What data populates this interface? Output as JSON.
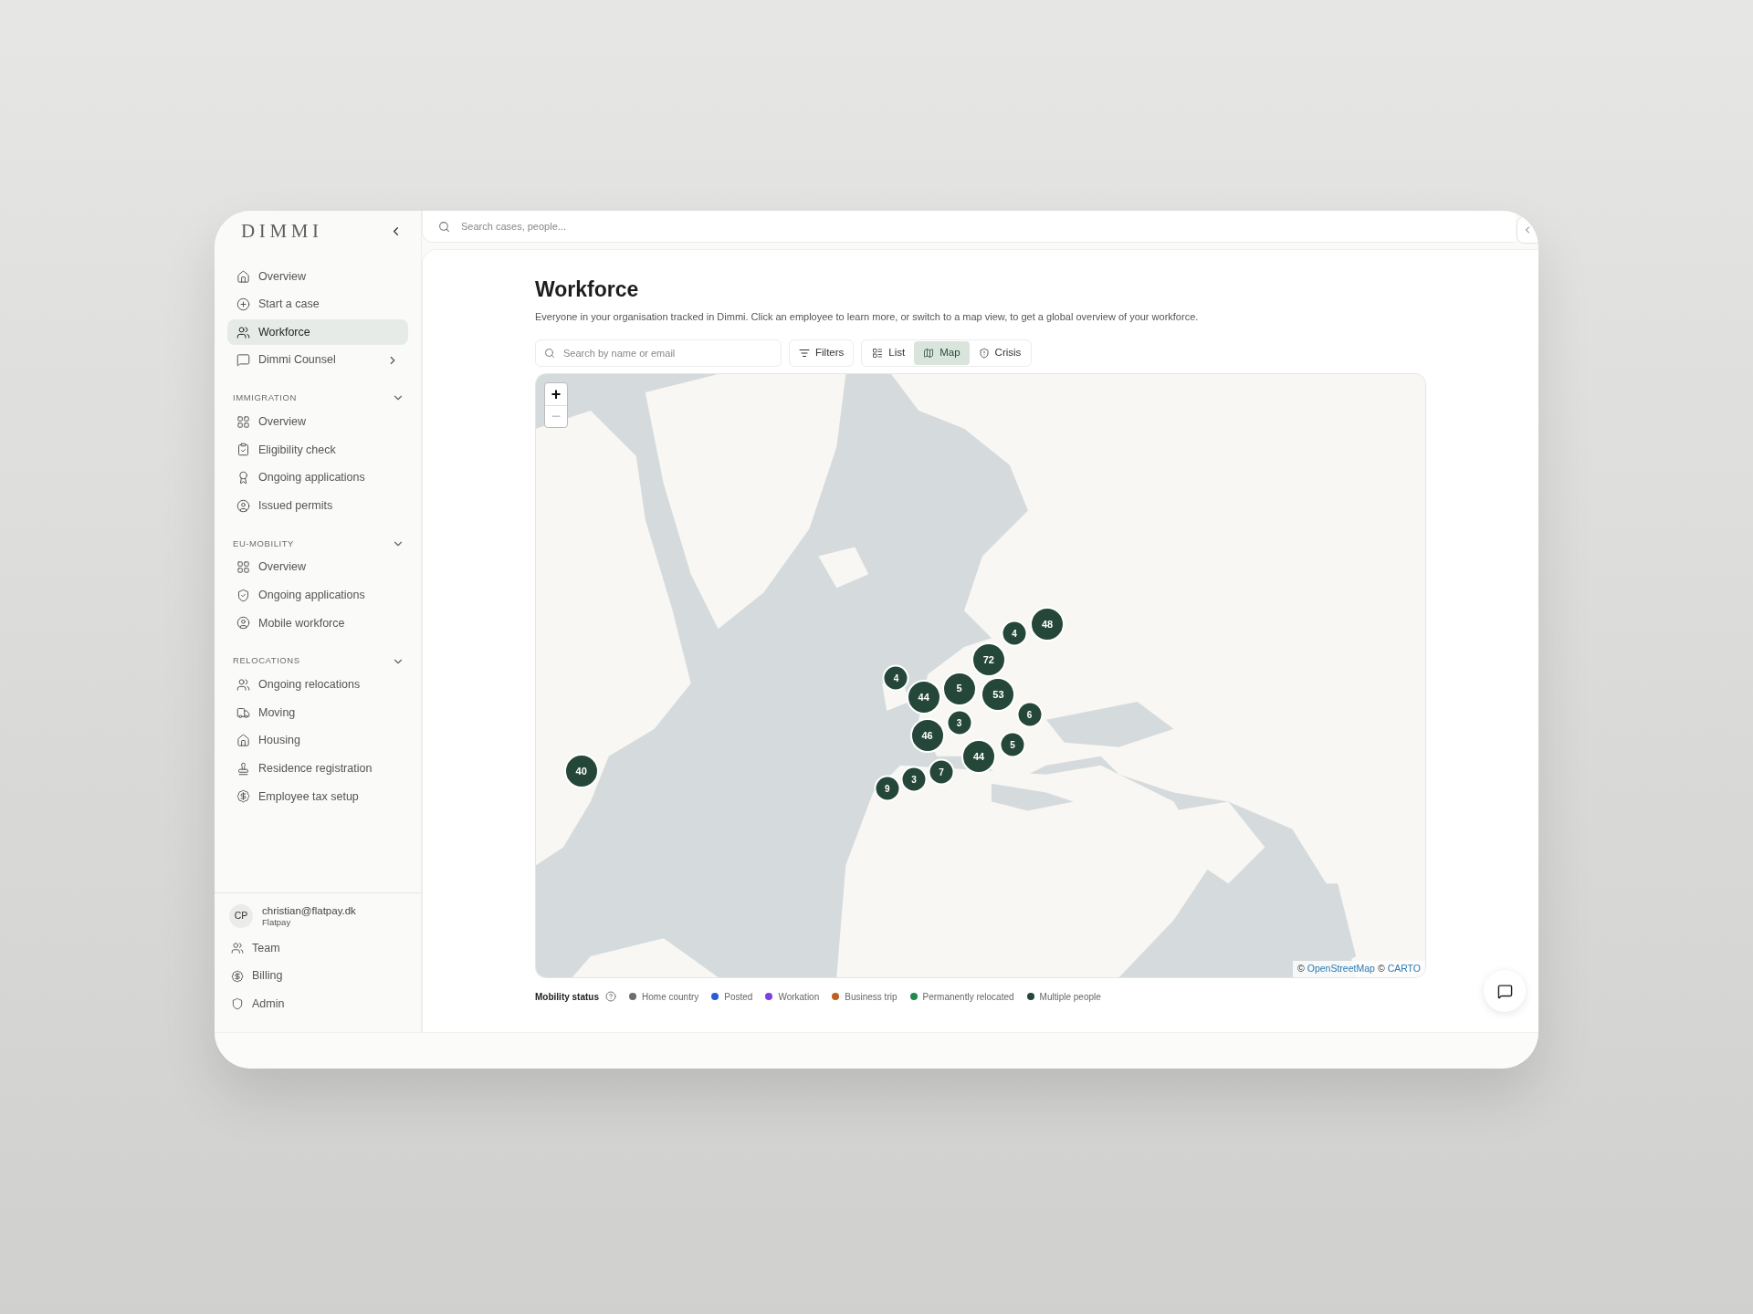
{
  "sidebar": {
    "logo": "DIMMI",
    "main_items": [
      {
        "label": "Overview",
        "selected": false,
        "submenu": false
      },
      {
        "label": "Start a case",
        "selected": false,
        "submenu": false
      },
      {
        "label": "Workforce",
        "selected": true,
        "submenu": false
      },
      {
        "label": "Dimmi Counsel",
        "selected": false,
        "submenu": true
      }
    ],
    "sections": [
      {
        "title": "IMMIGRATION",
        "expanded": true,
        "items": [
          {
            "label": "Overview"
          },
          {
            "label": "Eligibility check"
          },
          {
            "label": "Ongoing applications"
          },
          {
            "label": "Issued permits"
          }
        ]
      },
      {
        "title": "EU-MOBILITY",
        "expanded": true,
        "items": [
          {
            "label": "Overview"
          },
          {
            "label": "Ongoing applications"
          },
          {
            "label": "Mobile workforce"
          }
        ]
      },
      {
        "title": "RELOCATIONS",
        "expanded": true,
        "items": [
          {
            "label": "Ongoing relocations"
          },
          {
            "label": "Moving"
          },
          {
            "label": "Housing"
          },
          {
            "label": "Residence registration"
          },
          {
            "label": "Employee tax setup"
          }
        ]
      }
    ],
    "account": {
      "initials": "CP",
      "email": "christian@flatpay.dk",
      "org": "Flatpay"
    },
    "footer_items": [
      {
        "label": "Team"
      },
      {
        "label": "Billing"
      },
      {
        "label": "Admin"
      }
    ]
  },
  "global_search": {
    "placeholder": "Search cases, people..."
  },
  "page": {
    "title": "Workforce",
    "description": "Everyone in your organisation tracked in Dimmi. Click an employee to learn more, or switch to a map view, to get a global overview of your workforce.",
    "search": {
      "placeholder": "Search by name or email"
    },
    "filters": "Filters",
    "views": [
      {
        "label": "List",
        "selected": false
      },
      {
        "label": "Map",
        "selected": true
      },
      {
        "label": "Crisis",
        "selected": false
      }
    ]
  },
  "map": {
    "zoom_controls": [
      {
        "label": "+",
        "disabled": false
      },
      {
        "label": "−",
        "disabled": true
      }
    ],
    "clusters": [
      {
        "label": "40",
        "kind": "large"
      },
      {
        "label": "5",
        "kind": "large"
      },
      {
        "label": "44",
        "kind": "large"
      },
      {
        "label": "3",
        "kind": "small"
      },
      {
        "label": "46",
        "kind": "large"
      },
      {
        "label": "4",
        "kind": "small"
      },
      {
        "label": "72",
        "kind": "large"
      },
      {
        "label": "53",
        "kind": "large"
      },
      {
        "label": "6",
        "kind": "small"
      },
      {
        "label": "5",
        "kind": "small"
      },
      {
        "label": "44",
        "kind": "large"
      },
      {
        "label": "4",
        "kind": "small"
      },
      {
        "label": "48",
        "kind": "large"
      },
      {
        "label": "7",
        "kind": "small"
      },
      {
        "label": "3",
        "kind": "small"
      },
      {
        "label": "9",
        "kind": "small"
      }
    ],
    "attribution": {
      "prefix": "©",
      "links": [
        "OpenStreetMap",
        "CARTO"
      ]
    }
  },
  "legend": {
    "title": "Mobility status",
    "items": [
      {
        "label": "Home country",
        "color": "#6b6e6c"
      },
      {
        "label": "Posted",
        "color": "#2a5bd7"
      },
      {
        "label": "Workation",
        "color": "#7b3fe4"
      },
      {
        "label": "Business trip",
        "color": "#c0601f"
      },
      {
        "label": "Permanently relocated",
        "color": "#1f8a4c"
      },
      {
        "label": "Multiple people",
        "color": "#24473a"
      }
    ]
  }
}
